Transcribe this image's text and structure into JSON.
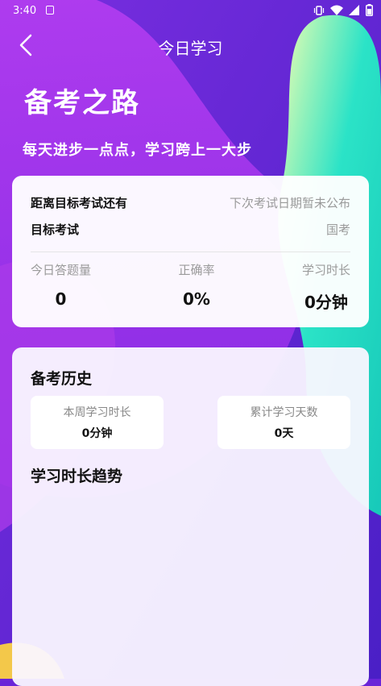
{
  "status_bar": {
    "time": "3:40"
  },
  "header": {
    "title": "今日学习"
  },
  "hero": {
    "title": "备考之路",
    "subtitle": "每天进步一点点，学习跨上一大步"
  },
  "target_card": {
    "countdown_label": "距离目标考试还有",
    "countdown_value": "下次考试日期暂未公布",
    "exam_label": "目标考试",
    "exam_value": "国考",
    "stats": [
      {
        "label": "今日答题量",
        "value": "0"
      },
      {
        "label": "正确率",
        "value": "0%"
      },
      {
        "label": "学习时长",
        "value": "0分钟"
      }
    ]
  },
  "history_card": {
    "title": "备考历史",
    "mini_stats": [
      {
        "label": "本周学习时长",
        "value": "0分钟"
      },
      {
        "label": "累计学习天数",
        "value": "0天"
      }
    ],
    "trend_title": "学习时长趋势"
  },
  "colors": {
    "bg_purple": "#6a24d8",
    "accent_cyan": "#1fe0c4",
    "card_bg": "#ffffff"
  }
}
